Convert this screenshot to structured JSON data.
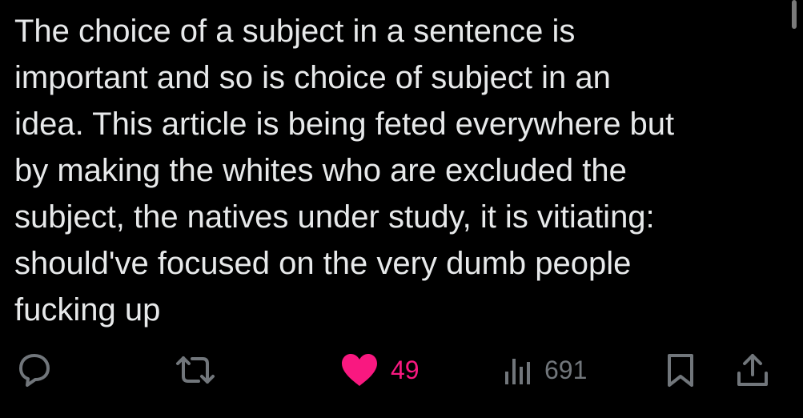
{
  "tweet": {
    "text": "The choice of a subject in a sentence is\nimportant and so is choice of subject in an\nidea. This article is being feted everywhere but\nby making the whites who are excluded the\nsubject, the natives under study, it is vitiating:\nshould've focused on the very dumb people\nfucking up"
  },
  "actions": {
    "reply_icon": "reply-icon",
    "retweet_icon": "retweet-icon",
    "like_icon": "heart-filled-icon",
    "like_count": "49",
    "views_icon": "views-bar-chart-icon",
    "views_count": "691",
    "bookmark_icon": "bookmark-icon",
    "share_icon": "share-icon"
  },
  "colors": {
    "background": "#000000",
    "text": "#e7e9ea",
    "icon_gray": "#71767b",
    "like_pink": "#f91880"
  }
}
